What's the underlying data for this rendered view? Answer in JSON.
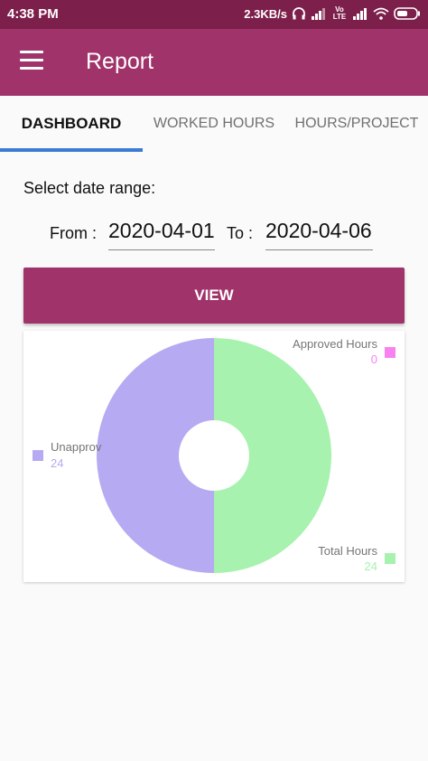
{
  "status": {
    "time": "4:38 PM",
    "speed": "2.3KB/s",
    "volte": "Vo LTE"
  },
  "app": {
    "title": "Report"
  },
  "tabs": [
    {
      "label": "DASHBOARD",
      "active": true
    },
    {
      "label": "WORKED HOURS",
      "active": false
    },
    {
      "label": "HOURS/PROJECT",
      "active": false
    }
  ],
  "form": {
    "range_label": "Select date range:",
    "from_label": "From :",
    "from_value": "2020-04-01",
    "to_label": "To :",
    "to_value": "2020-04-06",
    "view_label": "VIEW"
  },
  "colors": {
    "status_bar": "#7d1f4b",
    "app_bar": "#a0336a",
    "tab_indicator": "#3a7bd5"
  },
  "chart_data": {
    "type": "pie",
    "series": [
      {
        "name": "Approved Hours",
        "value": 0,
        "color": "#f883f0"
      },
      {
        "name": "Unapproved Hours",
        "label_shown": "Unapprov",
        "value": 24,
        "color": "#b6aaf2"
      },
      {
        "name": "Total Hours",
        "value": 24,
        "color": "#a6f2ae"
      }
    ],
    "legend": "around chart"
  }
}
